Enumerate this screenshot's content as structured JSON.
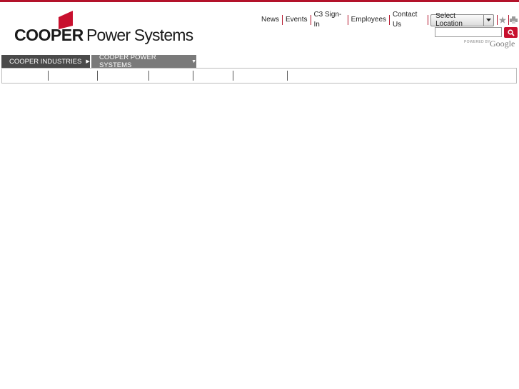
{
  "brand": {
    "name_bold": "COOPER",
    "name_rest": "Power Systems",
    "mark_color": "#c8102e"
  },
  "utility": {
    "links": [
      "News",
      "Events",
      "C3 Sign-In",
      "Employees",
      "Contact Us"
    ],
    "location_select": "Select Location"
  },
  "search": {
    "placeholder": "",
    "powered_by": "POWERED BY",
    "provider": "Google"
  },
  "tabs": [
    {
      "label": "COOPER INDUSTRIES",
      "caret": "▶"
    },
    {
      "label": "COOPER POWER SYSTEMS",
      "caret": "▼"
    }
  ],
  "colors": {
    "accent": "#b3122a",
    "tab_dark": "#4a4a4a",
    "tab_light": "#7a7a7a"
  }
}
